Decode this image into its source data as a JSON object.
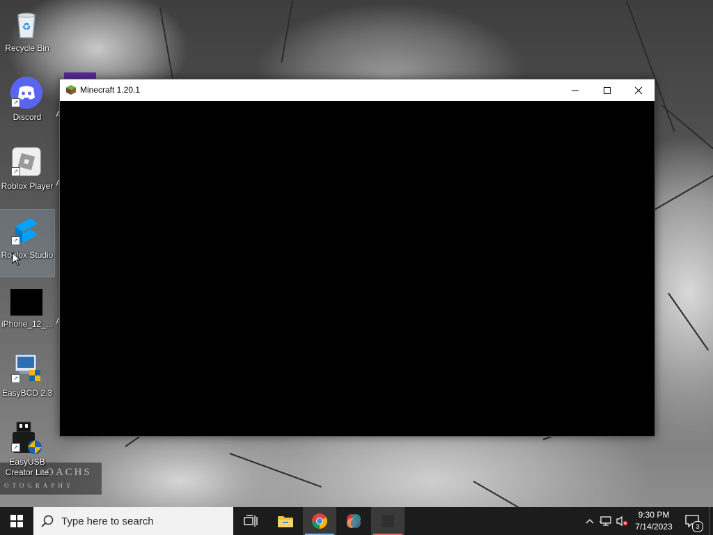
{
  "desktop": {
    "icons": [
      {
        "label": "Recycle Bin"
      },
      {
        "label": "Discord"
      },
      {
        "label": "Roblox Player"
      },
      {
        "label": "Roblox Studio"
      },
      {
        "label": "iPhone_12_..."
      },
      {
        "label": "EasyBCD 2.3"
      },
      {
        "label": "EasyUSB Creator Lite"
      }
    ],
    "partial_labels": [
      "A",
      "A",
      "A"
    ],
    "watermark": {
      "line1": "OACHS",
      "line2": "OTOGRAPHY"
    }
  },
  "window": {
    "title": "Minecraft 1.20.1",
    "minimize_icon": "minimize-icon",
    "maximize_icon": "maximize-icon",
    "close_icon": "close-icon"
  },
  "taskbar": {
    "search_placeholder": "Type here to search",
    "apps": [
      "task-view",
      "file-explorer",
      "chrome",
      "color-app",
      "minecraft"
    ],
    "clock_time": "9:30 PM",
    "clock_date": "7/14/2023",
    "notification_count": "3"
  },
  "colors": {
    "taskbar": "#1c1c1c",
    "search": "#f2f2f2",
    "active_underline": "#76b9ed"
  }
}
